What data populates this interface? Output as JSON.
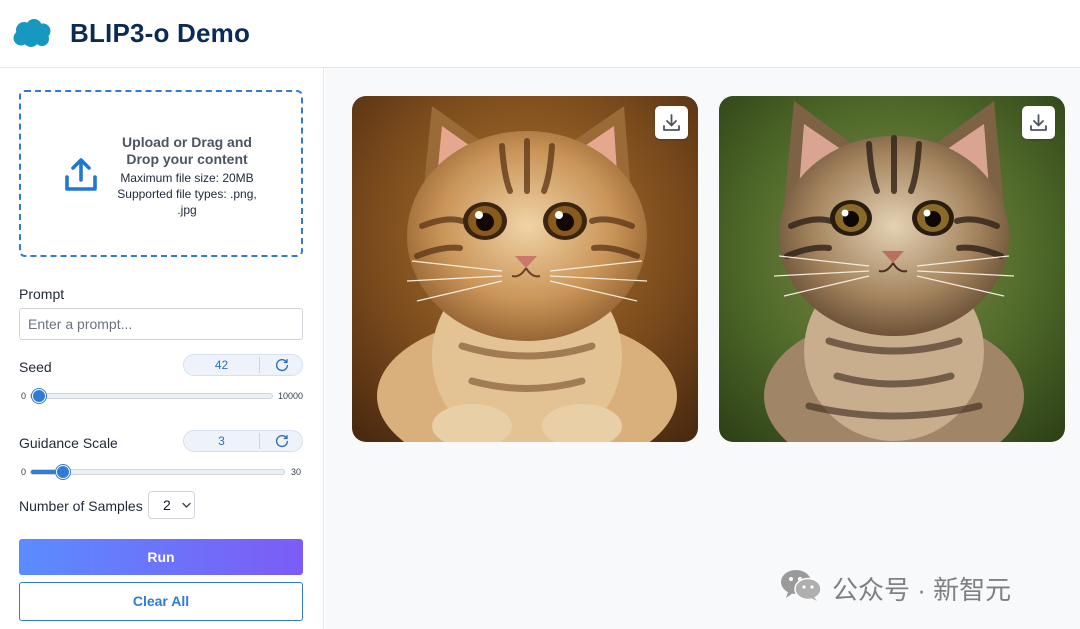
{
  "header": {
    "title": "BLIP3-o Demo",
    "logo": "salesforce-cloud-icon"
  },
  "upload": {
    "title": "Upload or Drag and Drop your content",
    "max_size": "Maximum file size: 20MB",
    "file_types": "Supported file types: .png, .jpg",
    "icon": "upload-icon"
  },
  "prompt": {
    "label": "Prompt",
    "placeholder": "Enter a prompt...",
    "value": ""
  },
  "seed": {
    "label": "Seed",
    "value": "42",
    "min": "0",
    "max": "10000",
    "fraction": 0.0042
  },
  "guidance": {
    "label": "Guidance Scale",
    "value": "3",
    "min": "0",
    "max": "30",
    "fraction": 0.1
  },
  "samples": {
    "label": "Number of Samples",
    "value": "2"
  },
  "buttons": {
    "run": "Run",
    "clear": "Clear All"
  },
  "results": [
    {
      "alt": "kitten-image-1",
      "download_icon": "download-icon"
    },
    {
      "alt": "kitten-image-2",
      "download_icon": "download-icon"
    }
  ],
  "watermark": {
    "text": "公众号 · 新智元",
    "icon": "wechat-icon"
  },
  "colors": {
    "accent": "#2f7bd6",
    "title": "#0b2a55",
    "run_gradient_start": "#5b8cff",
    "run_gradient_end": "#7c5cf5"
  }
}
